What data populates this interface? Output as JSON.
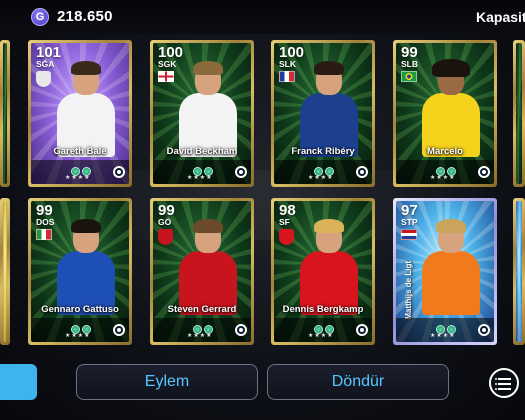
{
  "currency": {
    "icon": "G",
    "value": "218.650"
  },
  "header": {
    "right_label": "Kapasit"
  },
  "cards_row1": [
    {
      "rating": "101",
      "position": "SĞA",
      "name": "Gareth Bale",
      "theme": "purple"
    },
    {
      "rating": "100",
      "position": "SGK",
      "name": "David Beckham",
      "theme": "green"
    },
    {
      "rating": "100",
      "position": "SLK",
      "name": "Franck Ribéry",
      "theme": "green"
    },
    {
      "rating": "99",
      "position": "SLB",
      "name": "Marcelo",
      "theme": "green"
    }
  ],
  "cards_row2": [
    {
      "rating": "99",
      "position": "DOS",
      "name": "Gennaro Gattuso",
      "theme": "green"
    },
    {
      "rating": "99",
      "position": "GÖ",
      "name": "Steven Gerrard",
      "theme": "green"
    },
    {
      "rating": "98",
      "position": "SF",
      "name": "Dennis Bergkamp",
      "theme": "green"
    },
    {
      "rating": "97",
      "position": "STP",
      "name": "Matthijs de Ligt",
      "theme": "blue"
    }
  ],
  "card_stars": "★★★★",
  "buttons": {
    "action": "Eylem",
    "back": "Döndür"
  },
  "icons": {
    "currency": "coin-g-icon",
    "menu": "list-menu-icon",
    "card_logo": "efootball-logo-icon"
  }
}
